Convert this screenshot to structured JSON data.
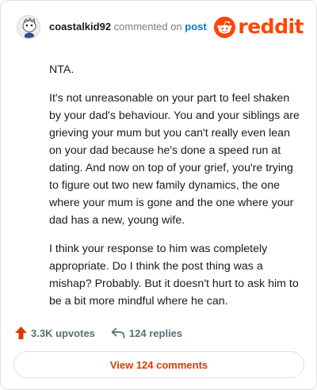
{
  "header": {
    "username": "coastalkid92",
    "verb": "commented on",
    "target": "post",
    "brand": "reddit"
  },
  "comment": {
    "paragraphs": [
      "NTA.",
      "It's not unreasonable on your part to feel shaken by your dad's behaviour. You and your siblings are grieving your mum but you can't really even lean on your dad because he's done a speed run at dating. And now on top of your grief, you're trying to figure out two new family dynamics, the one where your mum is gone and the one where your dad has a new, young wife.",
      "I think your response to him was completely appropriate. Do I think the post thing was a mishap? Probably. But it doesn't hurt to ask him to be a bit more mindful where he can."
    ]
  },
  "footer": {
    "upvotes": "3.3K upvotes",
    "replies": "124 replies",
    "view_comments": "View 124 comments"
  },
  "colors": {
    "brand": "#ff4500",
    "upvote": "#d93a00",
    "link": "#0079d3",
    "muted": "#576f76"
  },
  "icons": [
    "avatar-icon",
    "reddit-snoo-icon",
    "upvote-arrow-icon",
    "reply-arrow-icon"
  ]
}
